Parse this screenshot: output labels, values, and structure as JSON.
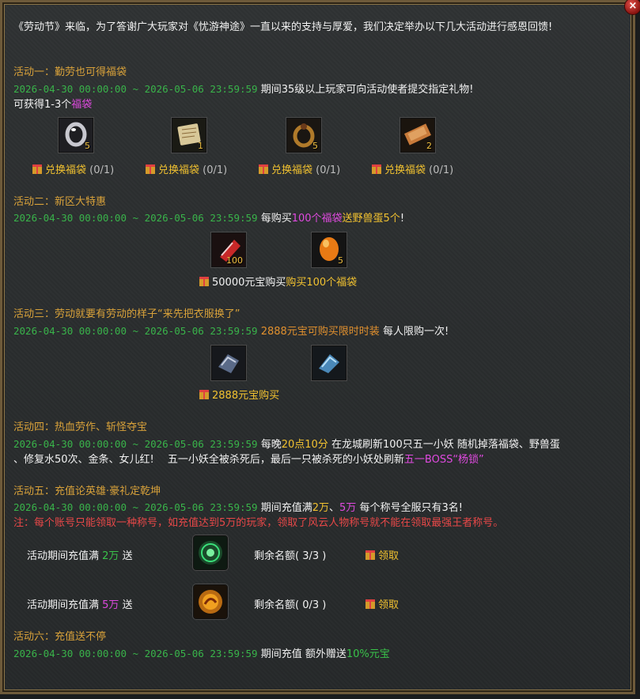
{
  "intro": "《劳动节》来临，为了答谢广大玩家对《忧游神途》一直以来的支持与厚爱，我们决定举办以下几大活动进行感恩回馈!",
  "date_range": "2026-04-30 00:00:00 ~ 2026-05-06 23:59:59",
  "close_label": "×",
  "a1": {
    "title": "活动一：勤劳也可得福袋",
    "desc": "期间35级以上玩家可向活动使者提交指定礼物!",
    "line2a": "可获得1-3个",
    "line2b": "福袋",
    "items": [
      {
        "icon": "silver-ring-icon",
        "count": "5"
      },
      {
        "icon": "scroll-icon",
        "count": "1"
      },
      {
        "icon": "gold-ring-icon",
        "count": "5"
      },
      {
        "icon": "parchment-icon",
        "count": "2"
      }
    ],
    "buttons": [
      {
        "label": "兑换福袋",
        "progress": "(0/1)"
      },
      {
        "label": "兑换福袋",
        "progress": "(0/1)"
      },
      {
        "label": "兑换福袋",
        "progress": "(0/1)"
      },
      {
        "label": "兑换福袋",
        "progress": "(0/1)"
      }
    ]
  },
  "a2": {
    "title": "活动二：新区大特惠",
    "d1": "每购买",
    "d2": "100个福袋",
    "d3": "送野兽蛋5个",
    "d4": "!",
    "items": [
      {
        "icon": "lucky-bag-icon",
        "count": "100"
      },
      {
        "icon": "beast-egg-icon",
        "count": "5"
      }
    ],
    "btn_a": "50000元宝购买",
    "btn_b": "购买100个福袋"
  },
  "a3": {
    "title": "活动三：劳动就要有劳动的样子“来先把衣服换了”",
    "d1": "2888元宝可购买限时时装",
    "d2": "每人限购一次!",
    "items": [
      {
        "icon": "armor-male-icon"
      },
      {
        "icon": "armor-female-icon"
      }
    ],
    "btn": "2888元宝购买"
  },
  "a4": {
    "title": "活动四：热血劳作、斩怪夺宝",
    "d1": "每晚",
    "d2": "20点10分",
    "d3": "在龙城刷新100只五一小妖 随机掉落福袋、野兽蛋",
    "l2a": "、修复水50次、金条、女儿红!　 五一小妖全被杀死后，最后一只被杀死的小妖处刷新",
    "l2b": "五一BOSS“杨锁”"
  },
  "a5": {
    "title": "活动五：充值论英雄·豪礼定乾坤",
    "d1": "期间充值满",
    "d2": "2万",
    "d3": "、",
    "d4": "5万",
    "d5": "每个称号全服只有3名!",
    "note": "注：每个账号只能领取一种称号，如充值达到5万的玩家，领取了风云人物称号就不能在领取最强王者称号。",
    "rows": [
      {
        "prefix": "活动期间充值满",
        "amount": "2万",
        "suffix": "送",
        "icon": "green-title-orb-icon",
        "remain": "剩余名额( 3/3 )",
        "claim": "领取"
      },
      {
        "prefix": "活动期间充值满",
        "amount": "5万",
        "suffix": "送",
        "icon": "gold-title-orb-icon",
        "remain": "剩余名额( 0/3 )",
        "claim": "领取"
      }
    ]
  },
  "a6": {
    "title": "活动六：充值送不停",
    "d1": "期间充值 额外赠送",
    "d2": "10%元宝"
  },
  "colors": {
    "title": "#d9a23a",
    "date": "#39b34a",
    "highlight_pink": "#e04ae0",
    "highlight_yellow": "#f2c230",
    "warning_red": "#e84848"
  }
}
